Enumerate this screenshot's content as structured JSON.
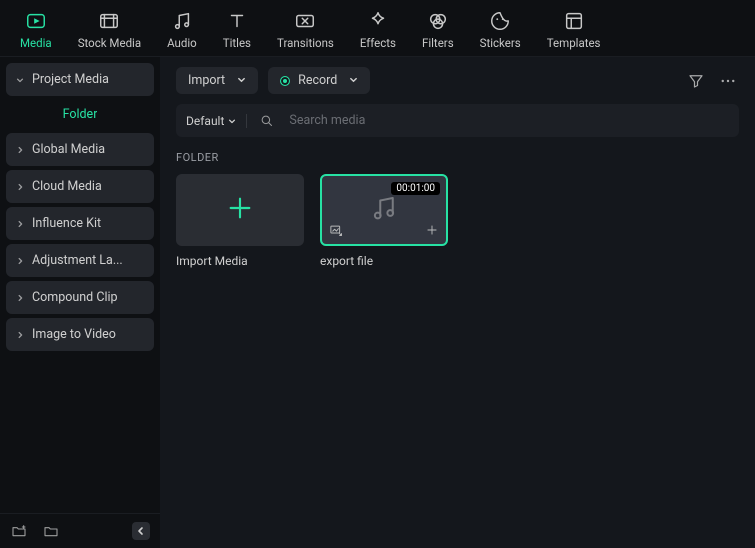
{
  "accent": "#27e2a4",
  "top_toolbar": [
    {
      "key": "media",
      "label": "Media",
      "active": true
    },
    {
      "key": "stock-media",
      "label": "Stock Media",
      "active": false
    },
    {
      "key": "audio",
      "label": "Audio",
      "active": false
    },
    {
      "key": "titles",
      "label": "Titles",
      "active": false
    },
    {
      "key": "transitions",
      "label": "Transitions",
      "active": false
    },
    {
      "key": "effects",
      "label": "Effects",
      "active": false
    },
    {
      "key": "filters",
      "label": "Filters",
      "active": false
    },
    {
      "key": "stickers",
      "label": "Stickers",
      "active": false
    },
    {
      "key": "templates",
      "label": "Templates",
      "active": false
    }
  ],
  "sidebar": {
    "items": [
      {
        "label": "Project Media",
        "expanded": true
      },
      {
        "label": "Folder",
        "sub": true
      },
      {
        "label": "Global Media"
      },
      {
        "label": "Cloud Media"
      },
      {
        "label": "Influence Kit"
      },
      {
        "label": "Adjustment La..."
      },
      {
        "label": "Compound Clip"
      },
      {
        "label": "Image to Video"
      }
    ]
  },
  "content_top": {
    "import_label": "Import",
    "record_label": "Record"
  },
  "search": {
    "sort_label": "Default",
    "placeholder": "Search media"
  },
  "section_title": "FOLDER",
  "cards": {
    "import_label": "Import Media",
    "clip": {
      "label": "export file",
      "duration": "00:01:00"
    }
  }
}
